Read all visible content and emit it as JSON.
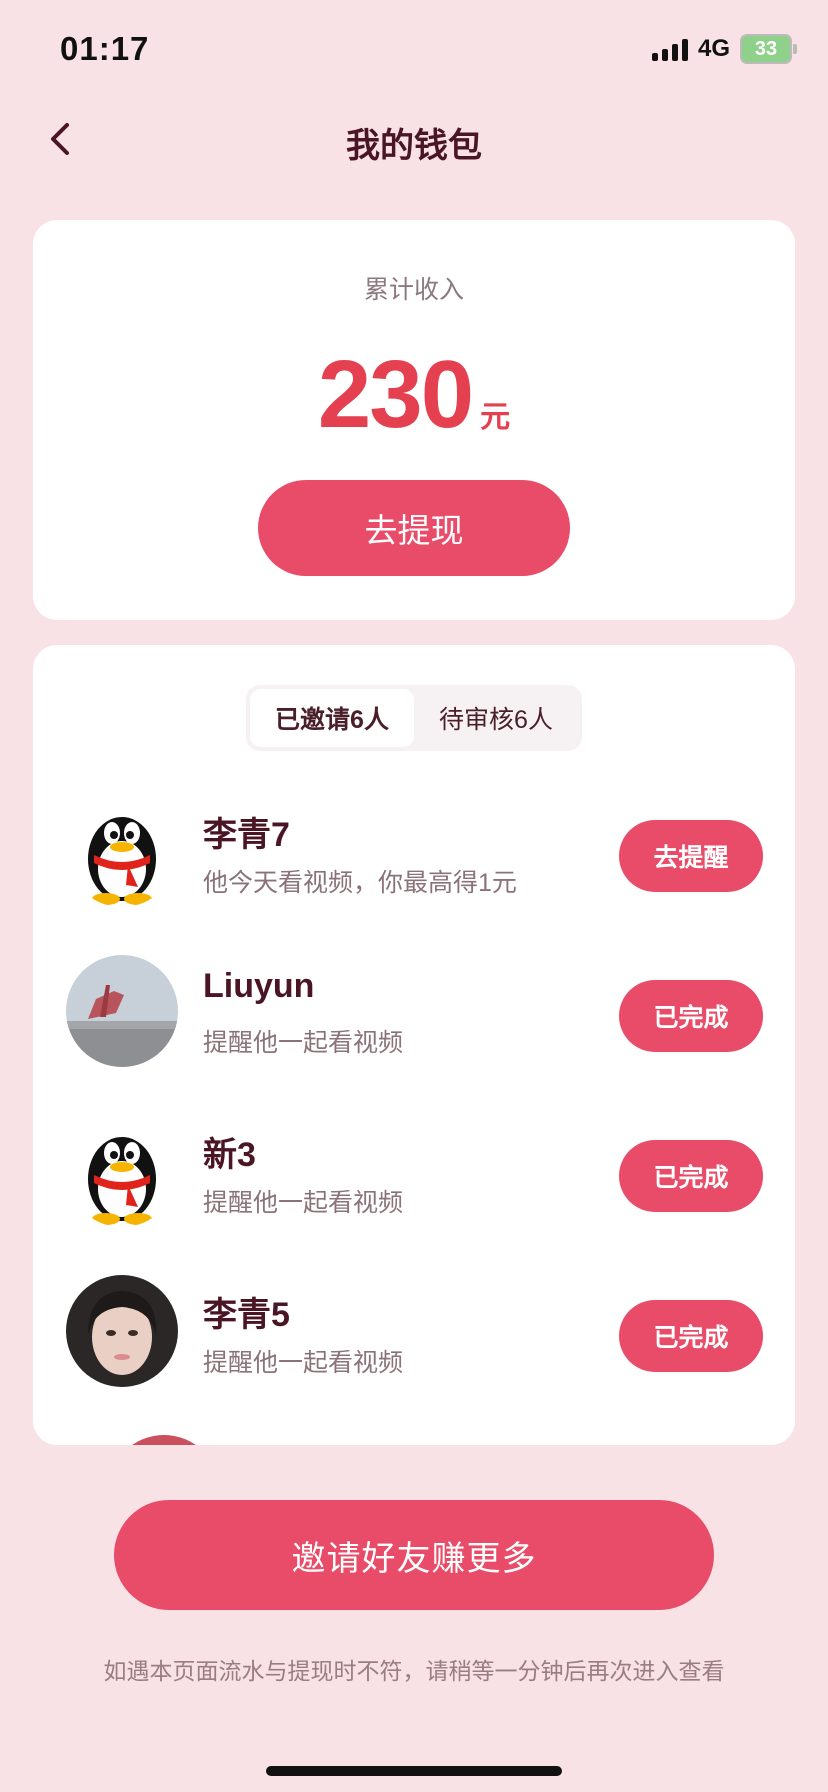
{
  "status_bar": {
    "time": "01:17",
    "network": "4G",
    "battery": "33"
  },
  "header": {
    "title": "我的钱包"
  },
  "income": {
    "label": "累计收入",
    "value": "230",
    "unit": "元",
    "withdraw_label": "去提现"
  },
  "tabs": [
    {
      "label": "已邀请6人",
      "active": true
    },
    {
      "label": "待审核6人",
      "active": false
    }
  ],
  "invites": [
    {
      "name": "李青7",
      "desc": "他今天看视频，你最高得1元",
      "action": "去提醒",
      "avatar": "qq-penguin-icon"
    },
    {
      "name": "Liuyun",
      "desc": "提醒他一起看视频",
      "action": "已完成",
      "avatar": "photo-avatar"
    },
    {
      "name": "新3",
      "desc": "提醒他一起看视频",
      "action": "已完成",
      "avatar": "qq-penguin-icon"
    },
    {
      "name": "李青5",
      "desc": "提醒他一起看视频",
      "action": "已完成",
      "avatar": "photo-avatar"
    }
  ],
  "footer": {
    "invite_more_label": "邀请好友赚更多",
    "note": "如遇本页面流水与提现时不符，请稍等一分钟后再次进入查看"
  },
  "colors": {
    "accent": "#e94c68",
    "amount": "#e4404f",
    "background": "#f8e2e5"
  }
}
